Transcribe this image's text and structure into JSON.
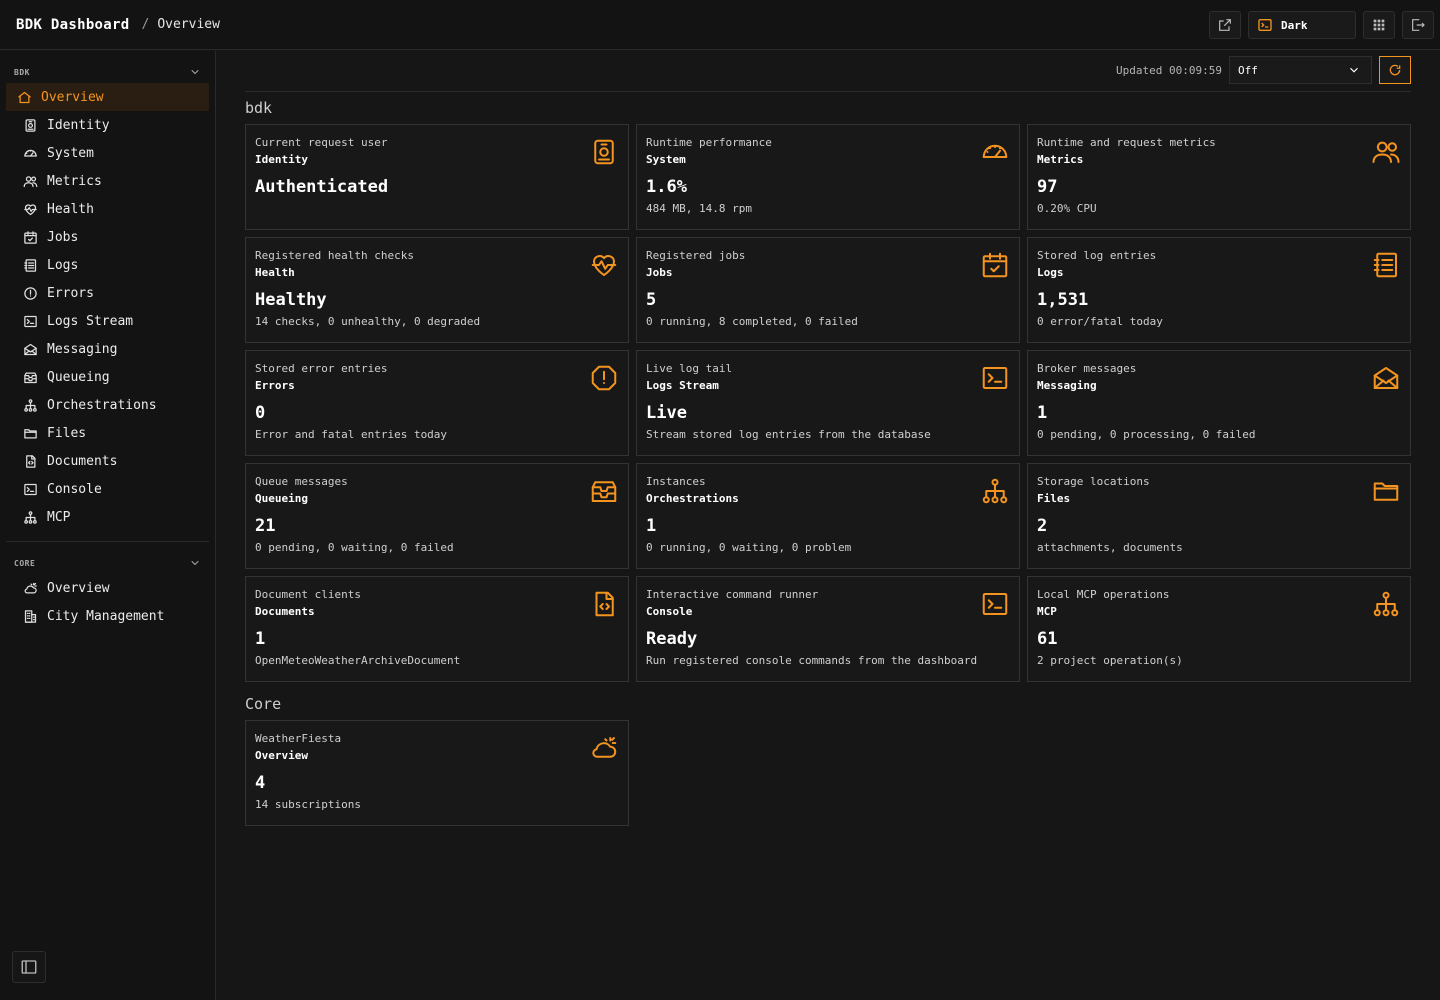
{
  "header": {
    "brand": "BDK Dashboard",
    "separator": "/",
    "page": "Overview",
    "theme_label": "Dark"
  },
  "accent_color": "#f39420",
  "sidebar": {
    "sections": [
      {
        "label": "BDK",
        "items": [
          {
            "label": "Overview",
            "icon": "home-icon",
            "active": true
          },
          {
            "label": "Identity",
            "icon": "id-badge-icon"
          },
          {
            "label": "System",
            "icon": "gauge-icon"
          },
          {
            "label": "Metrics",
            "icon": "users-icon"
          },
          {
            "label": "Health",
            "icon": "heart-pulse-icon"
          },
          {
            "label": "Jobs",
            "icon": "calendar-check-icon"
          },
          {
            "label": "Logs",
            "icon": "list-icon"
          },
          {
            "label": "Errors",
            "icon": "alert-circle-icon"
          },
          {
            "label": "Logs Stream",
            "icon": "terminal-icon"
          },
          {
            "label": "Messaging",
            "icon": "mail-icon"
          },
          {
            "label": "Queueing",
            "icon": "inbox-stack-icon"
          },
          {
            "label": "Orchestrations",
            "icon": "hierarchy-icon"
          },
          {
            "label": "Files",
            "icon": "folder-icon"
          },
          {
            "label": "Documents",
            "icon": "code-file-icon"
          },
          {
            "label": "Console",
            "icon": "terminal-icon"
          },
          {
            "label": "MCP",
            "icon": "hierarchy-icon"
          }
        ]
      },
      {
        "label": "CORE",
        "items": [
          {
            "label": "Overview",
            "icon": "weather-icon"
          },
          {
            "label": "City Management",
            "icon": "building-icon"
          }
        ]
      }
    ]
  },
  "toolbar": {
    "updated": "Updated 00:09:59",
    "refresh_option": "Off"
  },
  "groups": [
    {
      "title": "bdk",
      "cards": [
        {
          "subtitle": "Current request user",
          "title": "Identity",
          "value": "Authenticated",
          "detail": "",
          "icon": "id-badge-icon"
        },
        {
          "subtitle": "Runtime performance",
          "title": "System",
          "value": "1.6%",
          "detail": "484 MB, 14.8 rpm",
          "icon": "gauge-icon"
        },
        {
          "subtitle": "Runtime and request metrics",
          "title": "Metrics",
          "value": "97",
          "detail": "0.20% CPU",
          "icon": "users-icon"
        },
        {
          "subtitle": "Registered health checks",
          "title": "Health",
          "value": "Healthy",
          "detail": "14 checks, 0 unhealthy, 0 degraded",
          "icon": "heart-pulse-icon"
        },
        {
          "subtitle": "Registered jobs",
          "title": "Jobs",
          "value": "5",
          "detail": "0 running, 8 completed, 0 failed",
          "icon": "calendar-check-icon"
        },
        {
          "subtitle": "Stored log entries",
          "title": "Logs",
          "value": "1,531",
          "detail": "0 error/fatal today",
          "icon": "list-icon"
        },
        {
          "subtitle": "Stored error entries",
          "title": "Errors",
          "value": "0",
          "detail": "Error and fatal entries today",
          "icon": "alert-octagon-icon"
        },
        {
          "subtitle": "Live log tail",
          "title": "Logs Stream",
          "value": "Live",
          "detail": "Stream stored log entries from the database",
          "icon": "terminal-icon"
        },
        {
          "subtitle": "Broker messages",
          "title": "Messaging",
          "value": "1",
          "detail": "0 pending, 0 processing, 0 failed",
          "icon": "mail-icon"
        },
        {
          "subtitle": "Queue messages",
          "title": "Queueing",
          "value": "21",
          "detail": "0 pending, 0 waiting, 0 failed",
          "icon": "inbox-stack-icon"
        },
        {
          "subtitle": "Instances",
          "title": "Orchestrations",
          "value": "1",
          "detail": "0 running, 0 waiting, 0 problem",
          "icon": "hierarchy-icon"
        },
        {
          "subtitle": "Storage locations",
          "title": "Files",
          "value": "2",
          "detail": "attachments, documents",
          "icon": "folder-icon"
        },
        {
          "subtitle": "Document clients",
          "title": "Documents",
          "value": "1",
          "detail": "OpenMeteoWeatherArchiveDocument",
          "icon": "code-file-icon"
        },
        {
          "subtitle": "Interactive command runner",
          "title": "Console",
          "value": "Ready",
          "detail": "Run registered console commands from the dashboard",
          "icon": "terminal-icon"
        },
        {
          "subtitle": "Local MCP operations",
          "title": "MCP",
          "value": "61",
          "detail": "2 project operation(s)",
          "icon": "hierarchy-icon"
        }
      ]
    },
    {
      "title": "Core",
      "cards": [
        {
          "subtitle": "WeatherFiesta",
          "title": "Overview",
          "value": "4",
          "detail": "14 subscriptions",
          "icon": "weather-icon"
        }
      ]
    }
  ]
}
